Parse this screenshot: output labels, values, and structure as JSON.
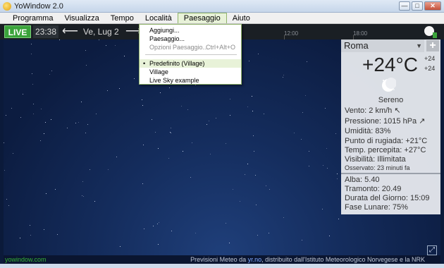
{
  "window": {
    "title": "YoWindow 2.0"
  },
  "menu": [
    "Programma",
    "Visualizza",
    "Tempo",
    "Località",
    "Paesaggio",
    "Aiuto"
  ],
  "topbar": {
    "live": "LIVE",
    "time": "23:38",
    "date": "Ve, Lug 2",
    "ticks": [
      "12:00",
      "18:00"
    ]
  },
  "dropdown": {
    "items": [
      {
        "label": "Aggiungi...",
        "shortcut": "",
        "disabled": false
      },
      {
        "label": "Paesaggio...",
        "shortcut": "",
        "disabled": false
      },
      {
        "label": "Opzioni Paesaggio...",
        "shortcut": "Ctrl+Alt+O",
        "disabled": true
      },
      {
        "label": "Predefinito (Village)",
        "shortcut": "",
        "selected": true
      },
      {
        "label": "Village",
        "shortcut": ""
      },
      {
        "label": "Live Sky example",
        "shortcut": ""
      }
    ]
  },
  "panel": {
    "city": "Roma",
    "temp": "+24°C",
    "temp_high": "+24",
    "temp_low": "+24",
    "condition": "Sereno",
    "details": [
      {
        "label": "Vento:",
        "value": "2 km/h"
      },
      {
        "label": "Pressione:",
        "value": "1015 hPa"
      },
      {
        "label": "Umidità:",
        "value": "83%"
      },
      {
        "label": "Punto di rugiada:",
        "value": "+21°C"
      },
      {
        "label": "Temp. percepita:",
        "value": "+27°C"
      },
      {
        "label": "Visibilità:",
        "value": "Illimitata"
      },
      {
        "label": "Osservato:",
        "value": "23 minuti fa"
      }
    ],
    "astro": [
      {
        "label": "Alba:",
        "value": "5.40"
      },
      {
        "label": "Tramonto:",
        "value": "20.49"
      },
      {
        "label": "Durata del Giorno:",
        "value": "15:09"
      },
      {
        "label": "Fase Lunare:",
        "value": "75%"
      }
    ]
  },
  "status": {
    "left": "yowindow.com",
    "right_prefix": "Previsioni Meteo da",
    "right_link": "yr.no",
    "right_suffix": ", distribuito dall'Istituto Meteorologico Norvegese e la NRK"
  }
}
